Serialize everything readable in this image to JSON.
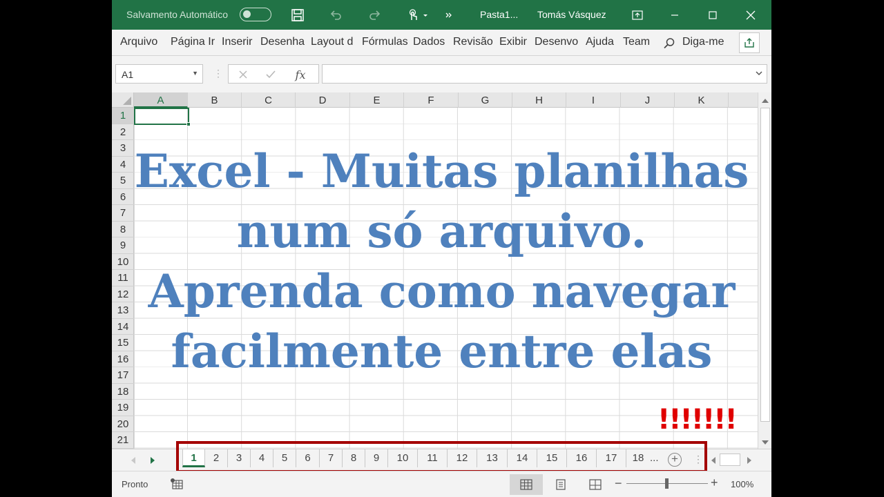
{
  "titlebar": {
    "autosave_label": "Salvamento Automático",
    "document_title": "Pasta1...",
    "user_name": "Tomás Vásquez"
  },
  "ribbon": {
    "tabs": [
      "Arquivo",
      "Página Ir",
      "Inserir",
      "Desenha",
      "Layout d",
      "Fórmulas",
      "Dados",
      "Revisão",
      "Exibir",
      "Desenvo",
      "Ajuda",
      "Team"
    ],
    "tell_me": "Diga-me"
  },
  "formula_bar": {
    "name_box": "A1",
    "fx_label": "fx",
    "formula_value": ""
  },
  "grid": {
    "columns": [
      "A",
      "B",
      "C",
      "D",
      "E",
      "F",
      "G",
      "H",
      "I",
      "J",
      "K"
    ],
    "rows": [
      "1",
      "2",
      "3",
      "4",
      "5",
      "6",
      "7",
      "8",
      "9",
      "10",
      "11",
      "12",
      "13",
      "14",
      "15",
      "16",
      "17",
      "18",
      "19",
      "20",
      "21"
    ],
    "active_cell": "A1"
  },
  "overlay": {
    "lines": [
      "Excel - Muitas planilhas",
      "num só arquivo.",
      "Aprenda como navegar",
      "facilmente entre elas"
    ],
    "exclamation": "!!!!!!!",
    "text_color": "#4f81bd",
    "exclamation_color": "#e00000"
  },
  "sheets": {
    "tabs": [
      "1",
      "2",
      "3",
      "4",
      "5",
      "6",
      "7",
      "8",
      "9",
      "10",
      "11",
      "12",
      "13",
      "14",
      "15",
      "16",
      "17",
      "18"
    ],
    "active": "1",
    "more": "...",
    "add": "+"
  },
  "statusbar": {
    "ready": "Pronto",
    "zoom": "100%"
  },
  "colors": {
    "accent": "#217346",
    "highlight_box": "#a40000"
  }
}
